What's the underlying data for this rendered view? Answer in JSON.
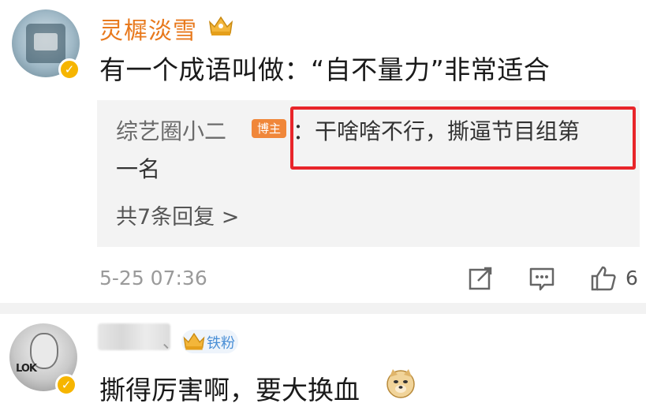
{
  "comment1": {
    "username": "灵樨淡雪",
    "avatar_icon": "avatar-icon",
    "verify_icon": "verified-badge-icon",
    "badge_icon": "crown-badge-icon",
    "text": "有一个成语叫做：“自不量力”非常适合",
    "reply": {
      "name": "综艺圈小二",
      "badge": "博主",
      "text_line1": "：干啥啥不行，撕逼节目组第",
      "text_line2": "一名",
      "more": "共7条回复 >"
    },
    "timestamp": "5-25 07:36",
    "like_count": "6"
  },
  "comment2": {
    "avatar_icon": "avatar-icon",
    "avatar_text": "LOK",
    "separator": "、",
    "fan_badge": "铁粉",
    "text": "撕得厉害啊，要大换血",
    "emoji_icon": "doge-emoji-icon"
  },
  "colors": {
    "username": "#e8791d",
    "highlight_border": "#e8252a",
    "bozhu_badge": "#f0873a",
    "verified": "#f6b500",
    "fan_badge_text": "#4a8fd6"
  }
}
